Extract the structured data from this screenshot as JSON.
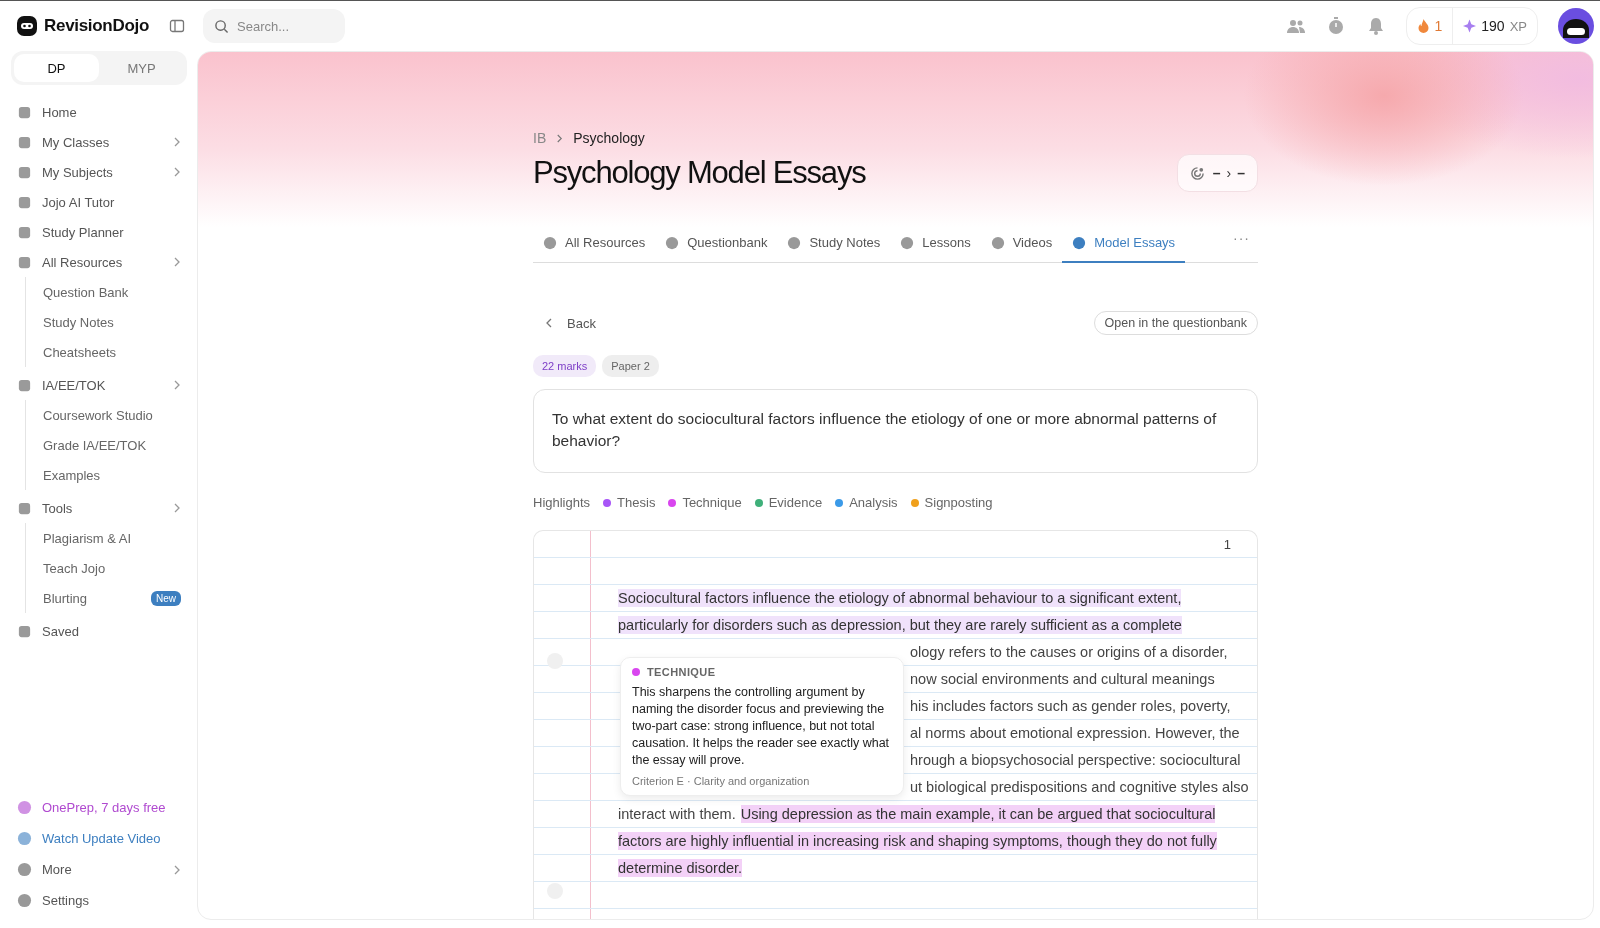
{
  "topbar": {
    "brand": "RevisionDojo",
    "search": {
      "placeholder": "Search..."
    },
    "streak": "1",
    "xp": {
      "value": "190",
      "unit": "XP"
    }
  },
  "sidebar": {
    "levels": [
      {
        "label": "DP",
        "selected": true
      },
      {
        "label": "MYP",
        "selected": false
      }
    ],
    "items": [
      {
        "label": "Home",
        "has_submenu": false
      },
      {
        "label": "My Classes",
        "has_submenu": true
      },
      {
        "label": "My Subjects",
        "has_submenu": true
      },
      {
        "label": "Jojo AI Tutor",
        "has_submenu": false
      },
      {
        "label": "Study Planner",
        "has_submenu": false
      },
      {
        "label": "All Resources",
        "has_submenu": true,
        "children": [
          {
            "label": "Question Bank"
          },
          {
            "label": "Study Notes"
          },
          {
            "label": "Cheatsheets"
          }
        ]
      },
      {
        "label": "IA/EE/TOK",
        "has_submenu": true,
        "children": [
          {
            "label": "Coursework Studio"
          },
          {
            "label": "Grade IA/EE/TOK"
          },
          {
            "label": "Examples"
          }
        ]
      },
      {
        "label": "Tools",
        "has_submenu": true,
        "children": [
          {
            "label": "Plagiarism & AI"
          },
          {
            "label": "Teach Jojo"
          },
          {
            "label": "Blurting",
            "badge": "New"
          }
        ]
      },
      {
        "label": "Saved",
        "has_submenu": false
      }
    ],
    "footer": [
      {
        "label": "OnePrep, 7 days free",
        "color": "#b04ad0",
        "has_submenu": false
      },
      {
        "label": "Watch Update Video",
        "color": "#3d7fc0",
        "has_submenu": false
      },
      {
        "label": "More",
        "color": "#555555",
        "has_submenu": true
      },
      {
        "label": "Settings",
        "color": "#555555",
        "has_submenu": false
      }
    ]
  },
  "header": {
    "breadcrumb": [
      "IB",
      "Psychology"
    ],
    "title": "Psychology Model Essays",
    "grade": {
      "from": "–",
      "separator": "›",
      "to": "–"
    }
  },
  "tabs": [
    {
      "label": "All Resources",
      "selected": false
    },
    {
      "label": "Questionbank",
      "selected": false
    },
    {
      "label": "Study Notes",
      "selected": false
    },
    {
      "label": "Lessons",
      "selected": false
    },
    {
      "label": "Videos",
      "selected": false
    },
    {
      "label": "Model Essays",
      "selected": true
    }
  ],
  "more_menu": "···",
  "back": "Back",
  "open_button": "Open in the questionbank",
  "tags": [
    {
      "label": "22 marks",
      "color": "#7e3fc7"
    },
    {
      "label": "Paper 2",
      "color": "#666666"
    }
  ],
  "question": "To what extent do sociocultural factors influence the etiology of one or more abnormal patterns of behavior?",
  "highlights": {
    "label": "Highlights",
    "items": [
      {
        "label": "Thesis",
        "color": "#a855f7"
      },
      {
        "label": "Technique",
        "color": "#d946ef"
      },
      {
        "label": "Evidence",
        "color": "#3fb07a"
      },
      {
        "label": "Analysis",
        "color": "#3b9ae8"
      },
      {
        "label": "Signposting",
        "color": "#f0a01c"
      }
    ]
  },
  "essay": {
    "page": "1",
    "lines": [
      {
        "covered": false,
        "segments": [
          {
            "text": "Sociocultural factors influence the etiology of abnormal behaviour to a significant extent,",
            "kind": "thesis"
          }
        ]
      },
      {
        "covered": false,
        "segments": [
          {
            "text": "particularly for disorders such as depression, but they are rarely sufficient as a complete",
            "kind": "thesis"
          }
        ]
      },
      {
        "covered": true,
        "segments": [
          {
            "text": "ology refers to the causes or origins of a disorder,",
            "kind": "plain"
          }
        ]
      },
      {
        "covered": true,
        "segments": [
          {
            "text": "now social environments and cultural meanings",
            "kind": "plain"
          }
        ]
      },
      {
        "covered": true,
        "segments": [
          {
            "text": "his includes factors such as gender roles, poverty,",
            "kind": "plain"
          }
        ]
      },
      {
        "covered": true,
        "segments": [
          {
            "text": "al norms about emotional expression. However, the",
            "kind": "plain"
          }
        ]
      },
      {
        "covered": true,
        "segments": [
          {
            "text": "hrough a biopsychosocial perspective: sociocultural",
            "kind": "plain"
          }
        ]
      },
      {
        "covered": true,
        "segments": [
          {
            "text": "ut biological predispositions and cognitive styles also",
            "kind": "plain"
          }
        ]
      },
      {
        "covered": false,
        "segments": [
          {
            "text": "interact with them.",
            "kind": "plain"
          },
          {
            "text": "Using depression as the main example, it can be argued that sociocultural",
            "kind": "technique"
          }
        ]
      },
      {
        "covered": false,
        "segments": [
          {
            "text": "factors are highly influential in increasing risk and shaping symptoms, though they do not fully",
            "kind": "technique"
          }
        ]
      },
      {
        "covered": false,
        "segments": [
          {
            "text": "determine disorder.",
            "kind": "technique"
          }
        ]
      }
    ]
  },
  "tooltip": {
    "label": "TECHNIQUE",
    "color": "#d946ef",
    "body": "This sharpens the controlling argument by naming the disorder focus and previewing the two-part case: strong influence, but not total causation. It helps the reader see exactly what the essay will prove.",
    "footer": "Criterion E · Clarity and organization"
  }
}
